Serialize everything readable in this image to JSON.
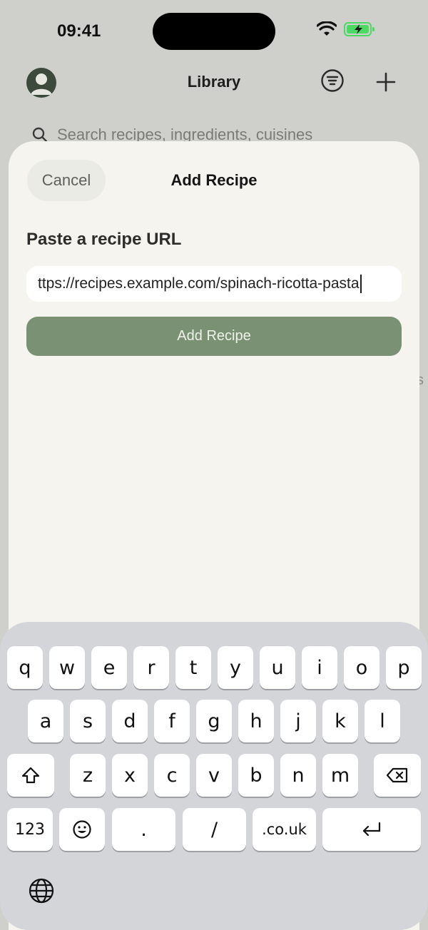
{
  "status_bar": {
    "time": "09:41"
  },
  "background": {
    "nav_title": "Library",
    "search_placeholder": "Search recipes, ingredients, cuisines",
    "peek_text": "s"
  },
  "sheet": {
    "title": "Add Recipe",
    "cancel_label": "Cancel",
    "field_label": "Paste a recipe URL",
    "url_value": "ttps://recipes.example.com/spinach-ricotta-pasta",
    "submit_label": "Add Recipe"
  },
  "keyboard": {
    "row1": [
      "q",
      "w",
      "e",
      "r",
      "t",
      "y",
      "u",
      "i",
      "o",
      "p"
    ],
    "row2": [
      "a",
      "s",
      "d",
      "f",
      "g",
      "h",
      "j",
      "k",
      "l"
    ],
    "row3": [
      "z",
      "x",
      "c",
      "v",
      "b",
      "n",
      "m"
    ],
    "numbers_label": "123",
    "dot_label": ".",
    "slash_label": "/",
    "domain_label": ".co.uk"
  },
  "colors": {
    "accent_green": "#7a9273",
    "sheet_bg": "#f5f4ef",
    "battery_green": "#4cd964"
  }
}
